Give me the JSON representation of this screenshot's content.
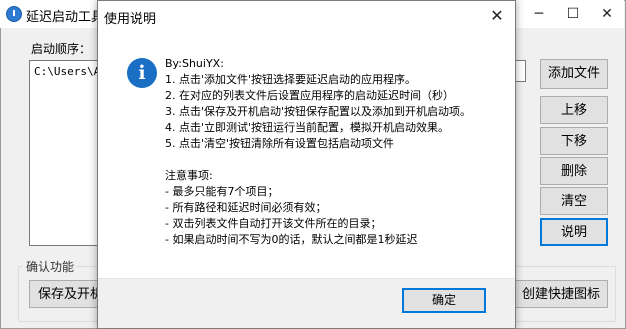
{
  "main_window": {
    "title": "延迟启动工具",
    "minimize": "─",
    "maximize": "☐",
    "close": "✕",
    "startup_order_label": "启动顺序：",
    "list_items": [
      "C:\\Users\\Ad"
    ],
    "buttons": {
      "add_file": "添加文件",
      "move_up": "上移",
      "move_down": "下移",
      "delete": "删除",
      "clear": "清空",
      "help": "说明",
      "save_and_boot": "保存及开机启",
      "create_shortcut": "创建快捷图标"
    },
    "confirm_group_label": "确认功能"
  },
  "dialog": {
    "title": "使用说明",
    "close": "✕",
    "icon": "info-icon",
    "lines": [
      "By:ShuiYX:",
      "1. 点击'添加文件'按钮选择要延迟启动的应用程序。",
      "2. 在对应的列表文件后设置应用程序的启动延迟时间（秒）",
      "3. 点击'保存及开机启动'按钮保存配置以及添加到开机启动项。",
      "4. 点击'立即测试'按钮运行当前配置，模拟开机启动效果。",
      "5. 点击'清空'按钮清除所有设置包括启动项文件",
      "",
      "注意事项:",
      "- 最多只能有7个项目；",
      "- 所有路径和延迟时间必须有效；",
      "- 双击列表文件自动打开该文件所在的目录；",
      "- 如果启动时间不写为0的话，默认之间都是1秒延迟"
    ],
    "ok": "确定"
  }
}
